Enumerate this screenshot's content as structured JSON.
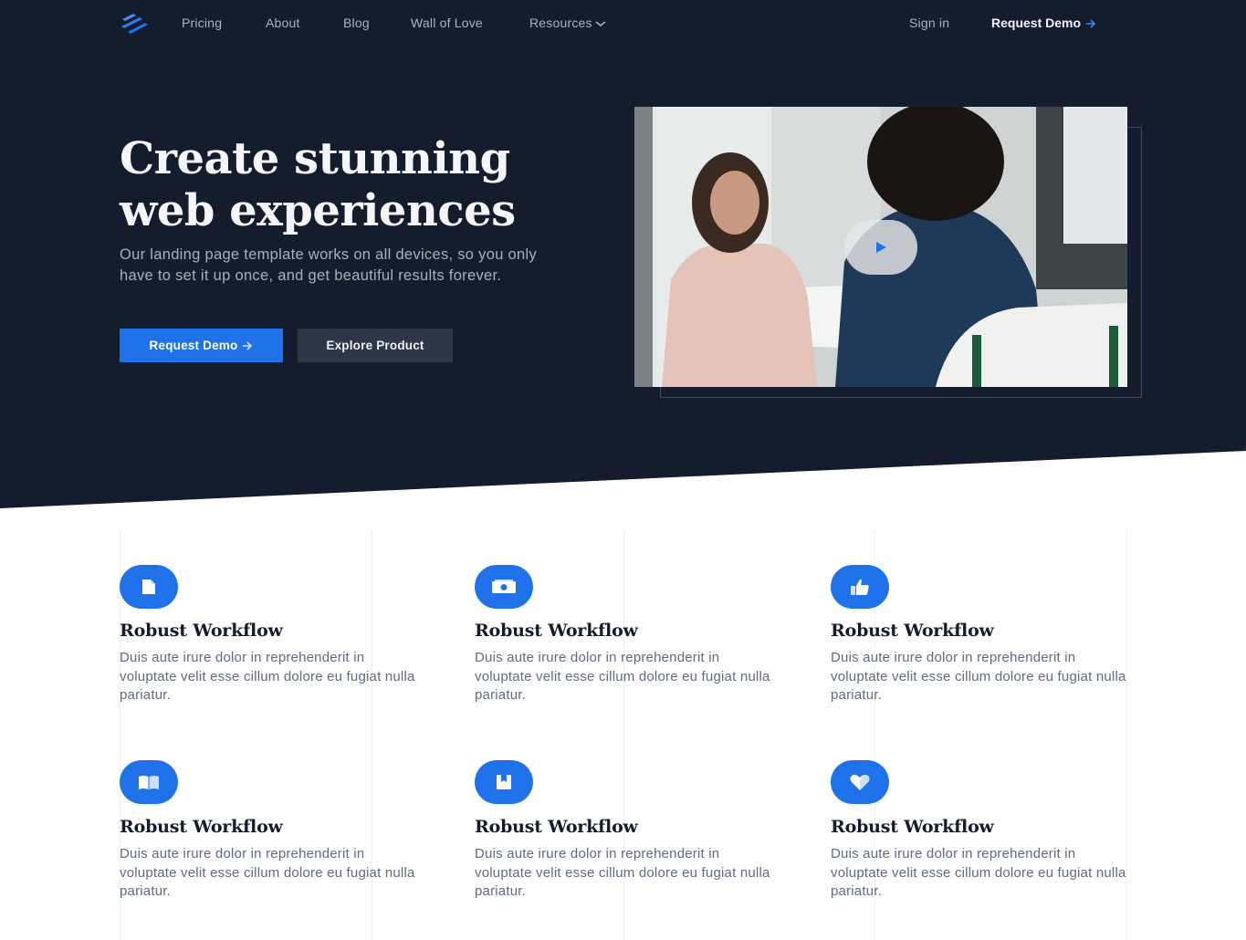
{
  "nav": {
    "links": [
      "Pricing",
      "About",
      "Blog",
      "Wall of Love",
      "Resources"
    ],
    "signin": "Sign in",
    "cta": "Request Demo"
  },
  "hero": {
    "title": "Create stunning web experiences",
    "subtitle": "Our landing page template works on all devices, so you only have to set it up once, and get beautiful results forever.",
    "primary_button": "Request Demo",
    "secondary_button": "Explore Product"
  },
  "features": [
    {
      "icon": "document-icon",
      "title": "Robust Workflow",
      "text": "Duis aute irure dolor in reprehenderit in voluptate velit esse cillum dolore eu fugiat nulla pariatur."
    },
    {
      "icon": "money-icon",
      "title": "Robust Workflow",
      "text": "Duis aute irure dolor in reprehenderit in voluptate velit esse cillum dolore eu fugiat nulla pariatur."
    },
    {
      "icon": "thumbs-up-icon",
      "title": "Robust Workflow",
      "text": "Duis aute irure dolor in reprehenderit in voluptate velit esse cillum dolore eu fugiat nulla pariatur."
    },
    {
      "icon": "book-icon",
      "title": "Robust Workflow",
      "text": "Duis aute irure dolor in reprehenderit in voluptate velit esse cillum dolore eu fugiat nulla pariatur."
    },
    {
      "icon": "bookmark-icon",
      "title": "Robust Workflow",
      "text": "Duis aute irure dolor in reprehenderit in voluptate velit esse cillum dolore eu fugiat nulla pariatur."
    },
    {
      "icon": "heart-icon",
      "title": "Robust Workflow",
      "text": "Duis aute irure dolor in reprehenderit in voluptate velit esse cillum dolore eu fugiat nulla pariatur."
    }
  ],
  "colors": {
    "hero_background": "#141d2d",
    "accent": "#1f72ea",
    "secondary_button": "#2c3748"
  }
}
